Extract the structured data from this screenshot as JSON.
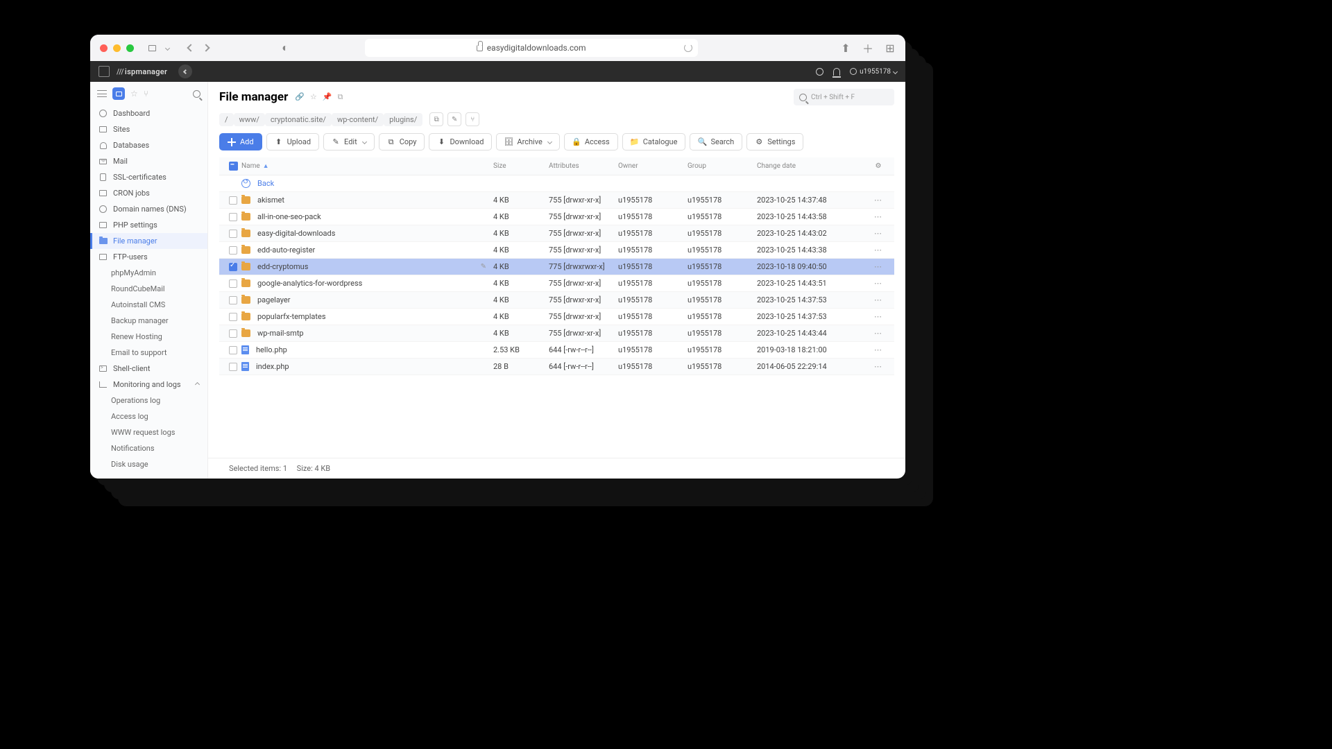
{
  "browser": {
    "url_host": "easydigitaldownloads.com"
  },
  "topbar": {
    "brand": "ispmanager",
    "user": "u1955178"
  },
  "sidebar": {
    "dashboard": "Dashboard",
    "sites": "Sites",
    "databases": "Databases",
    "mail": "Mail",
    "ssl": "SSL-certificates",
    "cron": "CRON jobs",
    "dns": "Domain names (DNS)",
    "php": "PHP settings",
    "fm": "File manager",
    "ftp": "FTP-users",
    "pma": "phpMyAdmin",
    "rcm": "RoundCubeMail",
    "autocms": "Autoinstall CMS",
    "backup": "Backup manager",
    "renew": "Renew Hosting",
    "support": "Email to support",
    "shell": "Shell-client",
    "monlog": "Monitoring and logs",
    "oplog": "Operations log",
    "acclog": "Access log",
    "wwwlog": "WWW request logs",
    "notif": "Notifications",
    "disk": "Disk usage"
  },
  "header": {
    "title": "File manager",
    "search_placeholder": "Ctrl + Shift + F"
  },
  "breadcrumb": [
    "/",
    "www/",
    "cryptonatic.site/",
    "wp-content/",
    "plugins/"
  ],
  "toolbar": {
    "add": "Add",
    "upload": "Upload",
    "edit": "Edit",
    "copy": "Copy",
    "download": "Download",
    "archive": "Archive",
    "access": "Access",
    "catalogue": "Catalogue",
    "search": "Search",
    "settings": "Settings"
  },
  "columns": {
    "name": "Name",
    "size": "Size",
    "attributes": "Attributes",
    "owner": "Owner",
    "group": "Group",
    "change": "Change date"
  },
  "back_label": "Back",
  "rows": [
    {
      "name": "akismet",
      "type": "folder",
      "size": "4 KB",
      "attr": "755 [drwxr-xr-x]",
      "owner": "u1955178",
      "group": "u1955178",
      "date": "2023-10-25 14:37:48",
      "selected": false
    },
    {
      "name": "all-in-one-seo-pack",
      "type": "folder",
      "size": "4 KB",
      "attr": "755 [drwxr-xr-x]",
      "owner": "u1955178",
      "group": "u1955178",
      "date": "2023-10-25 14:43:58",
      "selected": false
    },
    {
      "name": "easy-digital-downloads",
      "type": "folder",
      "size": "4 KB",
      "attr": "755 [drwxr-xr-x]",
      "owner": "u1955178",
      "group": "u1955178",
      "date": "2023-10-25 14:43:02",
      "selected": false
    },
    {
      "name": "edd-auto-register",
      "type": "folder",
      "size": "4 KB",
      "attr": "755 [drwxr-xr-x]",
      "owner": "u1955178",
      "group": "u1955178",
      "date": "2023-10-25 14:43:38",
      "selected": false
    },
    {
      "name": "edd-cryptomus",
      "type": "folder",
      "size": "4 KB",
      "attr": "775 [drwxrwxr-x]",
      "owner": "u1955178",
      "group": "u1955178",
      "date": "2023-10-18 09:40:50",
      "selected": true
    },
    {
      "name": "google-analytics-for-wordpress",
      "type": "folder",
      "size": "4 KB",
      "attr": "755 [drwxr-xr-x]",
      "owner": "u1955178",
      "group": "u1955178",
      "date": "2023-10-25 14:43:51",
      "selected": false
    },
    {
      "name": "pagelayer",
      "type": "folder",
      "size": "4 KB",
      "attr": "755 [drwxr-xr-x]",
      "owner": "u1955178",
      "group": "u1955178",
      "date": "2023-10-25 14:37:53",
      "selected": false
    },
    {
      "name": "popularfx-templates",
      "type": "folder",
      "size": "4 KB",
      "attr": "755 [drwxr-xr-x]",
      "owner": "u1955178",
      "group": "u1955178",
      "date": "2023-10-25 14:37:53",
      "selected": false
    },
    {
      "name": "wp-mail-smtp",
      "type": "folder",
      "size": "4 KB",
      "attr": "755 [drwxr-xr-x]",
      "owner": "u1955178",
      "group": "u1955178",
      "date": "2023-10-25 14:43:44",
      "selected": false
    },
    {
      "name": "hello.php",
      "type": "file",
      "size": "2.53 KB",
      "attr": "644 [-rw-r--r--]",
      "owner": "u1955178",
      "group": "u1955178",
      "date": "2019-03-18 18:21:00",
      "selected": false
    },
    {
      "name": "index.php",
      "type": "file",
      "size": "28 B",
      "attr": "644 [-rw-r--r--]",
      "owner": "u1955178",
      "group": "u1955178",
      "date": "2014-06-05 22:29:14",
      "selected": false
    }
  ],
  "footer": {
    "selected": "Selected items: 1",
    "size": "Size: 4 KB"
  }
}
